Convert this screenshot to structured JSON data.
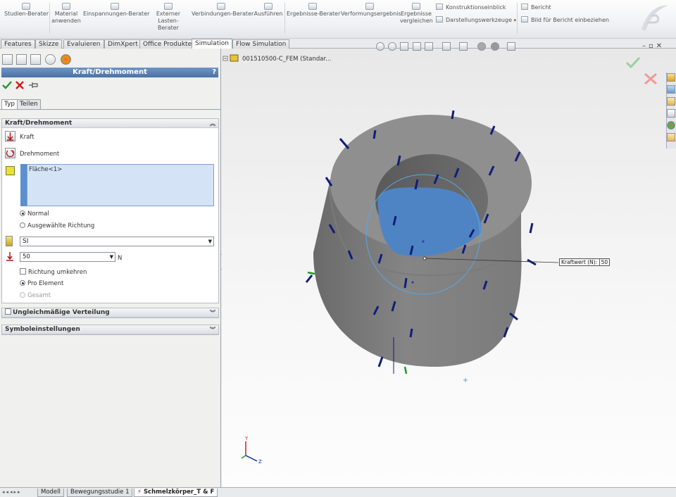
{
  "ribbon": {
    "buttons": [
      {
        "label": "Studien-Berater",
        "icon": "study-advisor-icon"
      },
      {
        "label": "Material anwenden",
        "icon": "material-icon"
      },
      {
        "label": "Einspannungen-Berater",
        "icon": "fixture-icon"
      },
      {
        "label": "Externer Lasten-Berater",
        "icon": "external-load-icon"
      },
      {
        "label": "Verbindungen-Berater",
        "icon": "connections-icon"
      },
      {
        "label": "Ausführen",
        "icon": "run-icon"
      },
      {
        "label": "Ergebnisse-Berater",
        "icon": "results-advisor-icon"
      },
      {
        "label": "Verformungsergebnis",
        "icon": "deformation-icon"
      },
      {
        "label": "Ergebnisse vergleichen",
        "icon": "compare-icon"
      }
    ],
    "small_items": [
      {
        "label": "Konstruktionseinblick",
        "icon": "insight-icon"
      },
      {
        "label": "Darstellungswerkzeuge",
        "icon": "plot-tools-icon"
      },
      {
        "label": "Bericht",
        "icon": "report-icon"
      },
      {
        "label": "Bild für Bericht einbeziehen",
        "icon": "image-report-icon"
      }
    ]
  },
  "tabs": [
    "Features",
    "Skizze",
    "Evaluieren",
    "DimXpert",
    "Office Produkte",
    "Simulation",
    "Flow Simulation"
  ],
  "active_tab": "Simulation",
  "panel": {
    "title": "Kraft/Drehmoment",
    "help": "?",
    "subtabs": [
      "Typ",
      "Teilen"
    ],
    "group1": {
      "header": "Kraft/Drehmoment",
      "force_label": "Kraft",
      "torque_label": "Drehmoment",
      "selection": "Fläche<1>",
      "radio_normal": "Normal",
      "radio_direction": "Ausgewählte Richtung",
      "unit": "SI",
      "value": "50",
      "value_unit": "N",
      "reverse_label": "Richtung umkehren",
      "per_element": "Pro Element",
      "total": "Gesamt"
    },
    "group2": "Ungleichmäßige Verteilung",
    "group3": "Symboleinstellungen"
  },
  "viewport": {
    "tree_label": "001510500-C_FEM  (Standar...",
    "callout_label": "Kraftwert (N):",
    "callout_value": "50",
    "colors": {
      "part": "#8c8c8c",
      "face": "#4f84c4",
      "arrow": "#101d7a"
    }
  },
  "bottom_tabs": [
    "Modell",
    "Bewegungsstudie 1",
    "Schmelzkörper_T & F"
  ],
  "active_bottom_tab": "Schmelzkörper_T & F"
}
